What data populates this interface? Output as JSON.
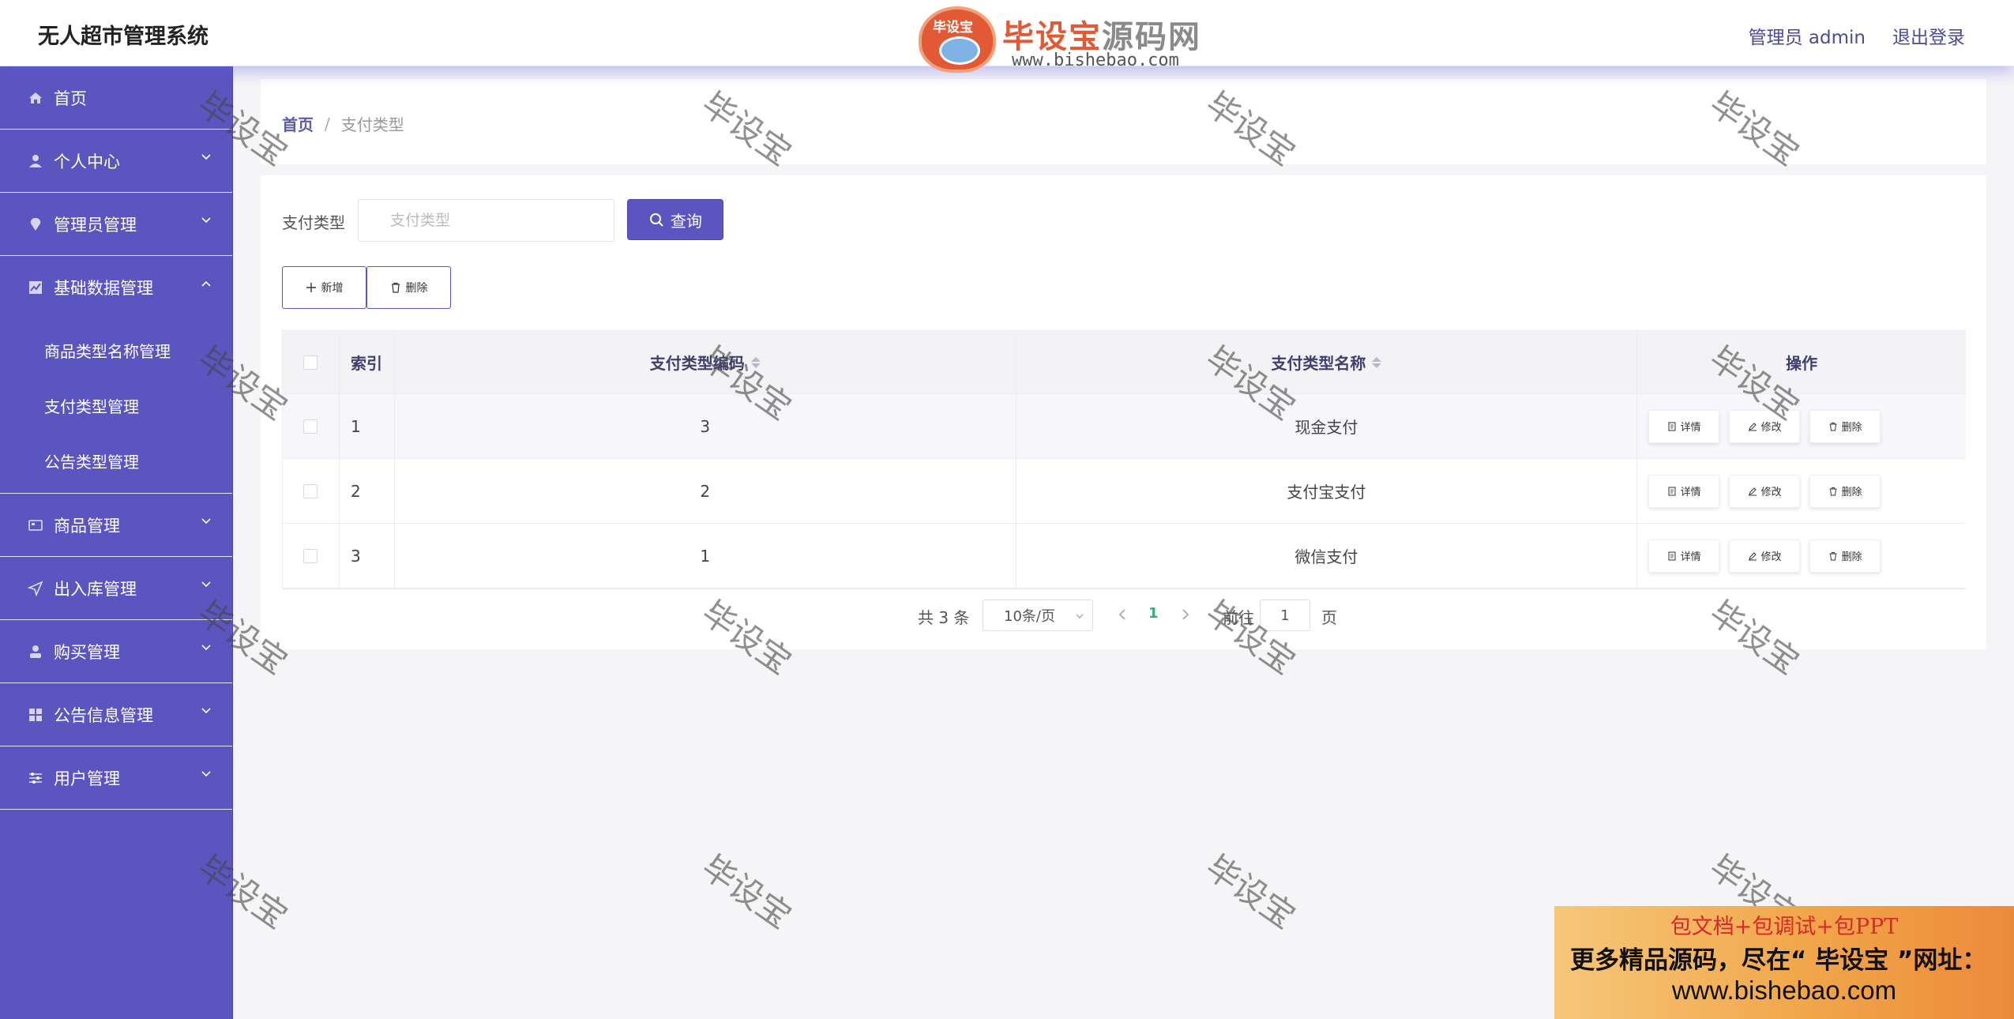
{
  "header": {
    "app_title": "无人超市管理系统",
    "logo_badge": "毕设宝",
    "logo_main_prefix": "毕设宝",
    "logo_main_suffix": "源码网",
    "logo_url": "www.bishebao.com",
    "user_label": "管理员 admin",
    "logout_label": "退出登录"
  },
  "sidebar": {
    "items": [
      {
        "label": "首页",
        "icon": "home-icon"
      },
      {
        "label": "个人中心",
        "icon": "user-icon"
      },
      {
        "label": "管理员管理",
        "icon": "location-icon"
      },
      {
        "label": "基础数据管理",
        "icon": "chart-icon",
        "expanded": true,
        "children": [
          {
            "label": "商品类型名称管理"
          },
          {
            "label": "支付类型管理"
          },
          {
            "label": "公告类型管理"
          }
        ]
      },
      {
        "label": "商品管理",
        "icon": "card-icon"
      },
      {
        "label": "出入库管理",
        "icon": "send-icon"
      },
      {
        "label": "购买管理",
        "icon": "person-icon"
      },
      {
        "label": "公告信息管理",
        "icon": "grid-icon"
      },
      {
        "label": "用户管理",
        "icon": "sliders-icon"
      }
    ]
  },
  "breadcrumb": {
    "home": "首页",
    "separator": "/",
    "current": "支付类型"
  },
  "search": {
    "label": "支付类型",
    "placeholder": "支付类型",
    "button": "查询"
  },
  "toolbar": {
    "add": "新增",
    "delete": "删除"
  },
  "table": {
    "headers": {
      "index": "索引",
      "code": "支付类型编码",
      "name": "支付类型名称",
      "operation": "操作"
    },
    "rows": [
      {
        "index": "1",
        "code": "3",
        "name": "现金支付"
      },
      {
        "index": "2",
        "code": "2",
        "name": "支付宝支付"
      },
      {
        "index": "3",
        "code": "1",
        "name": "微信支付"
      }
    ],
    "actions": {
      "detail": "详情",
      "edit": "修改",
      "delete": "删除"
    }
  },
  "pagination": {
    "total": "共 3 条",
    "page_size": "10条/页",
    "current_page": "1",
    "goto_label": "前往",
    "goto_value": "1",
    "page_suffix": "页"
  },
  "watermark": "毕设宝",
  "ad": {
    "line1": "包文档+包调试+包PPT",
    "line2": "更多精品源码，尽在“ 毕设宝 ”网址：",
    "line3": "www.bishebao.com"
  },
  "colors": {
    "sidebar": "#5b55c0",
    "accent": "#5b55c0",
    "pager_active": "#2bb27a"
  }
}
